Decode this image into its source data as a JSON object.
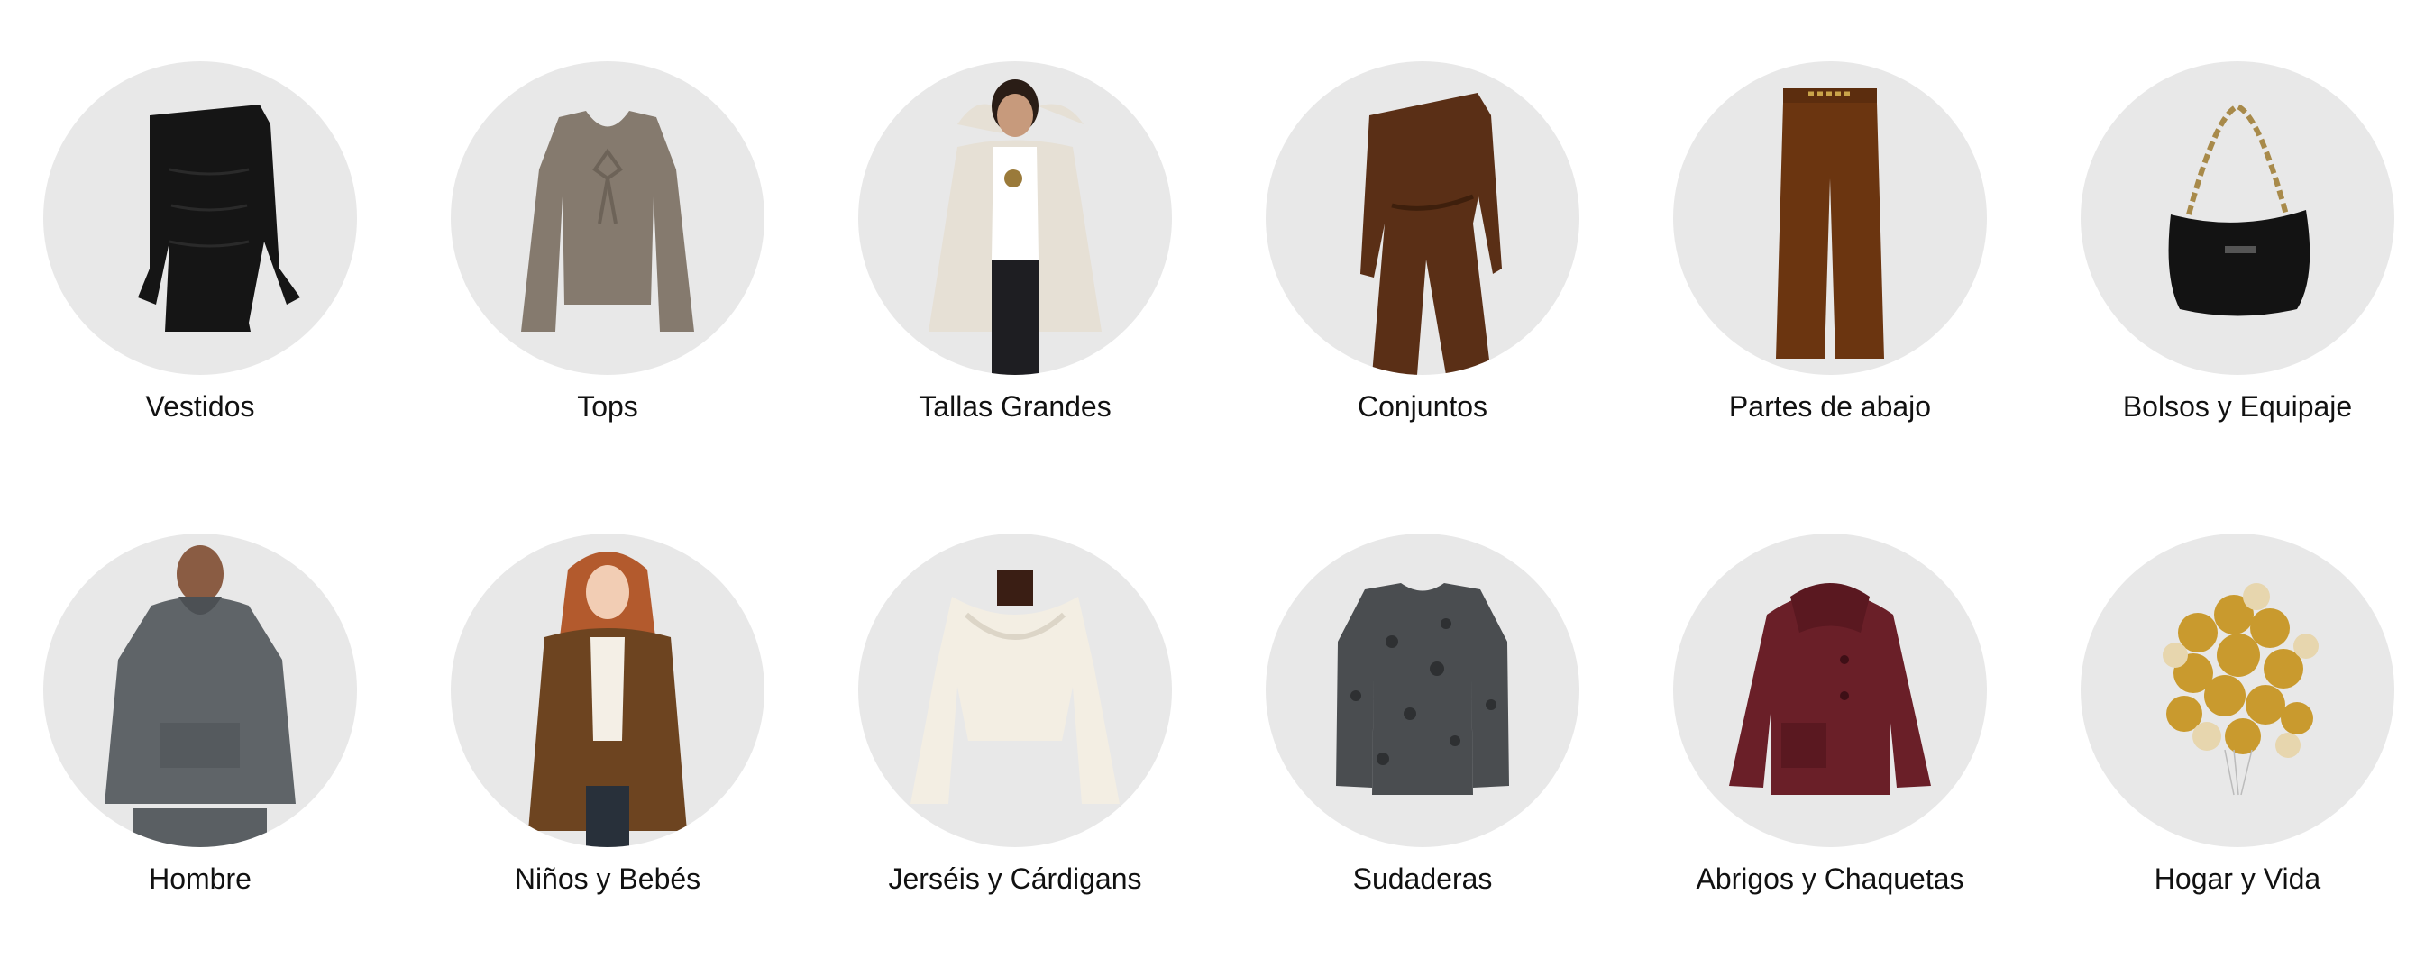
{
  "categories": [
    {
      "label": "Vestidos",
      "icon": "dress-icon"
    },
    {
      "label": "Tops",
      "icon": "blouse-icon"
    },
    {
      "label": "Tallas Grandes",
      "icon": "plus-size-model-icon"
    },
    {
      "label": "Conjuntos",
      "icon": "jumpsuit-icon"
    },
    {
      "label": "Partes de abajo",
      "icon": "trousers-icon"
    },
    {
      "label": "Bolsos y Equipaje",
      "icon": "handbag-icon"
    },
    {
      "label": "Hombre",
      "icon": "men-hoodie-icon"
    },
    {
      "label": "Niños y Bebés",
      "icon": "kids-jacket-icon"
    },
    {
      "label": "Jerséis y Cárdigans",
      "icon": "sweater-icon"
    },
    {
      "label": "Sudaderas",
      "icon": "sweatshirt-icon"
    },
    {
      "label": "Abrigos y Chaquetas",
      "icon": "coat-icon"
    },
    {
      "label": "Hogar y Vida",
      "icon": "balloons-icon"
    }
  ],
  "colors": {
    "circle_bg": "#e8e8e8",
    "label": "#111111"
  }
}
